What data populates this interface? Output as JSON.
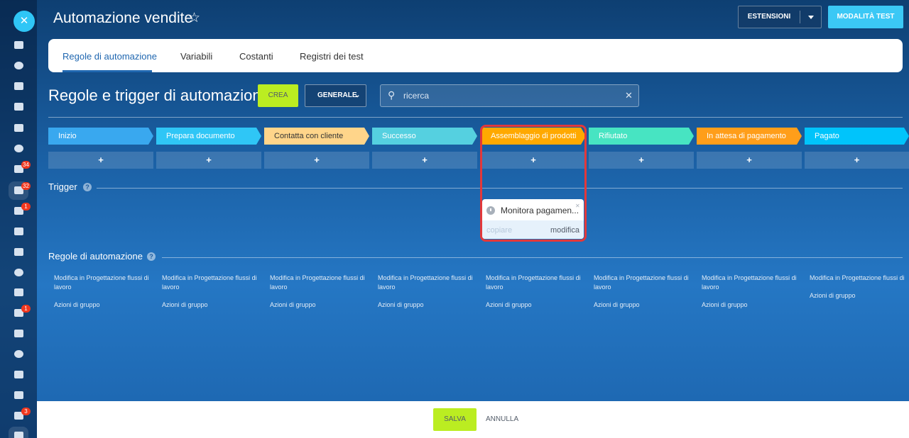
{
  "header": {
    "title": "Automazione vendite",
    "star_icon": "star-outline-icon",
    "extensions_label": "ESTENSIONI",
    "test_mode_label": "MODALITÀ TEST"
  },
  "left_rail": {
    "close_icon": "close-icon",
    "icons": [
      "home-icon",
      "nodes-icon",
      "feed-icon",
      "chat-icon",
      "calendar-icon",
      "target-icon",
      "tasks-icon",
      "filter-icon",
      "contacts-icon",
      "calendar-check-icon",
      "inbox-icon",
      "people-icon",
      "document-icon",
      "mail-icon",
      "store-icon",
      "analytics-icon",
      "cart-icon",
      "chart-icon",
      "robot-icon",
      "box-icon"
    ],
    "badges": {
      "tasks": "34",
      "filter": "32",
      "contacts": "1",
      "mail": "1",
      "robot": "3"
    }
  },
  "tabs": [
    {
      "label": "Regole di automazione",
      "active": true
    },
    {
      "label": "Variabili",
      "active": false
    },
    {
      "label": "Costanti",
      "active": false
    },
    {
      "label": "Registri dei test",
      "active": false
    }
  ],
  "section": {
    "title": "Regole e trigger di automazione",
    "create_label": "CREA",
    "filter_label": "GENERALE",
    "search_placeholder": "ricerca"
  },
  "stages": [
    {
      "name": "Inizio",
      "color": "#39a8ef"
    },
    {
      "name": "Prepara documento",
      "color": "#2fc6f6"
    },
    {
      "name": "Contatta con cliente",
      "color": "#ffd58a"
    },
    {
      "name": "Successo",
      "color": "#55d0e0"
    },
    {
      "name": "Assemblaggio di prodotti",
      "color": "#ffa900"
    },
    {
      "name": "Rifiutato",
      "color": "#47e4c2"
    },
    {
      "name": "In attesa di pagamento",
      "color": "#ff9e1a"
    },
    {
      "name": "Pagato",
      "color": "#00c4fb"
    }
  ],
  "add_label": "+",
  "trigger_section": {
    "title": "Trigger",
    "card": {
      "name": "Monitora pagamen...",
      "copy_label": "copiare",
      "edit_label": "modifica",
      "highlight_color": "#e3383a"
    }
  },
  "rules_section": {
    "title": "Regole di automazione",
    "columns": [
      {
        "edit": "Modifica in Progettazione flussi di lavoro",
        "group": "Azioni di gruppo"
      },
      {
        "edit": "Modifica in Progettazione flussi di lavoro",
        "group": "Azioni di gruppo"
      },
      {
        "edit": "Modifica in Progettazione flussi di lavoro",
        "group": "Azioni di gruppo"
      },
      {
        "edit": "Modifica in Progettazione flussi di lavoro",
        "group": "Azioni di gruppo"
      },
      {
        "edit": "Modifica in Progettazione flussi di lavoro",
        "group": "Azioni di gruppo"
      },
      {
        "edit": "Modifica in Progettazione flussi di lavoro",
        "group": "Azioni di gruppo"
      },
      {
        "edit": "Modifica in Progettazione flussi di lavoro",
        "group": "Azioni di gruppo"
      },
      {
        "edit": "Modifica in Progettazione flussi di lavoro",
        "group": "Azioni di gruppo"
      }
    ]
  },
  "footer": {
    "save_label": "SALVA",
    "cancel_label": "ANNULLA"
  },
  "colors": {
    "accent_green": "#bbed21",
    "accent_blue": "#3bc8f5",
    "tab_active": "#2067b0"
  }
}
